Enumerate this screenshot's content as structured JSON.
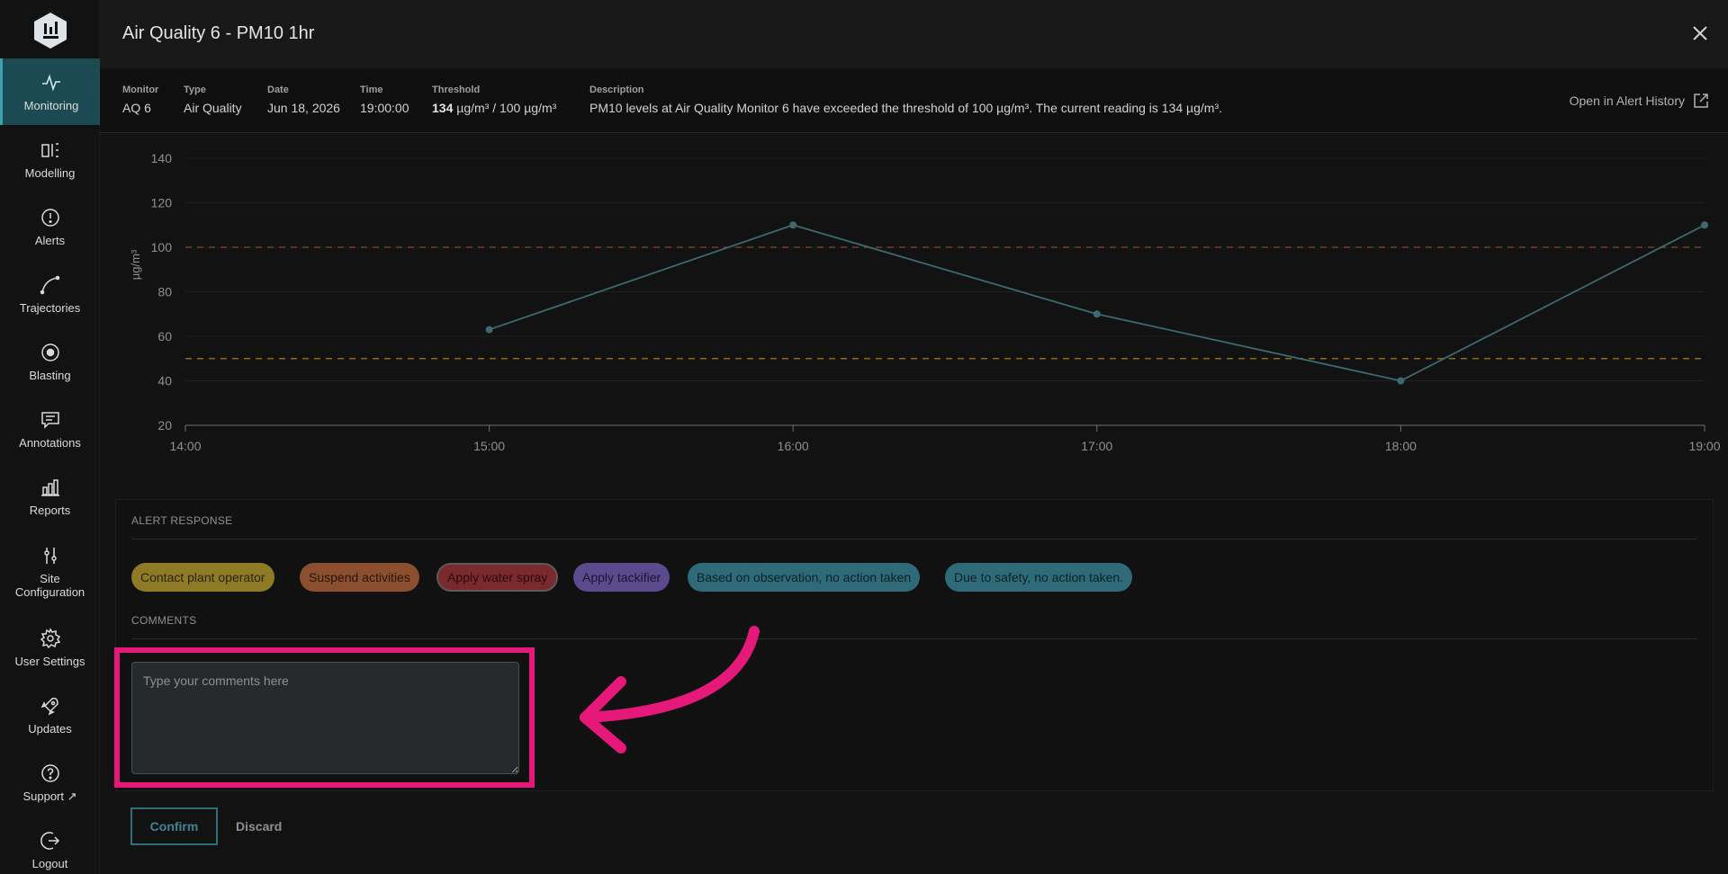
{
  "sidebar": {
    "items": [
      {
        "label": "Monitoring",
        "icon": "activity-icon"
      },
      {
        "label": "Modelling",
        "icon": "model-icon"
      },
      {
        "label": "Alerts",
        "icon": "alert-circle-icon"
      },
      {
        "label": "Trajectories",
        "icon": "trajectory-icon"
      },
      {
        "label": "Blasting",
        "icon": "blast-icon"
      },
      {
        "label": "Annotations",
        "icon": "annotation-icon"
      },
      {
        "label": "Reports",
        "icon": "bar-chart-icon"
      },
      {
        "label": "Site Configuration",
        "icon": "sliders-icon"
      },
      {
        "label": "User Settings",
        "icon": "gear-icon"
      },
      {
        "label": "Updates",
        "icon": "rocket-icon"
      },
      {
        "label": "Support",
        "icon": "help-icon"
      },
      {
        "label": "Logout",
        "icon": "logout-icon"
      }
    ]
  },
  "modal": {
    "title": "Air Quality 6 - PM10 1hr",
    "open_history": "Open in Alert History"
  },
  "info": {
    "monitor_label": "Monitor",
    "monitor_value": "AQ 6",
    "type_label": "Type",
    "type_value": "Air Quality",
    "date_label": "Date",
    "date_value": "Jun 18, 2026",
    "time_label": "Time",
    "time_value": "19:00:00",
    "threshold_label": "Threshold",
    "threshold_current": "134",
    "threshold_rest": " µg/m³ / 100 µg/m³",
    "description_label": "Description",
    "description_value": "PM10 levels at Air Quality Monitor 6 have exceeded the threshold of 100 µg/m³. The current reading is 134 µg/m³."
  },
  "chart_data": {
    "type": "line",
    "ylabel": "µg/m³",
    "x": [
      "15:00",
      "16:00",
      "17:00",
      "18:00",
      "19:00"
    ],
    "x_ticks": [
      "14:00",
      "15:00",
      "16:00",
      "17:00",
      "18:00",
      "19:00"
    ],
    "y_ticks": [
      20,
      40,
      60,
      80,
      100,
      120,
      140
    ],
    "ylim": [
      20,
      140
    ],
    "series": [
      {
        "values": [
          63,
          110,
          70,
          40,
          110
        ],
        "color": "#3d6a70"
      }
    ],
    "thresholds": [
      {
        "value": 100,
        "color": "#7a3a2a"
      },
      {
        "value": 50,
        "color": "#8a6a1e"
      }
    ],
    "grid": true
  },
  "response": {
    "section_title": "ALERT RESPONSE",
    "chips": [
      "Contact plant operator",
      "Suspend activities",
      "Apply water spray",
      "Apply tackifier",
      "Based on observation, no action taken",
      "Due to safety, no action taken."
    ],
    "comments_title": "COMMENTS",
    "comments_placeholder": "Type your comments here",
    "comments_value": ""
  },
  "actions": {
    "confirm": "Confirm",
    "discard": "Discard"
  },
  "colors": {
    "accent": "#3ea0ae",
    "highlight": "#e6197a"
  }
}
